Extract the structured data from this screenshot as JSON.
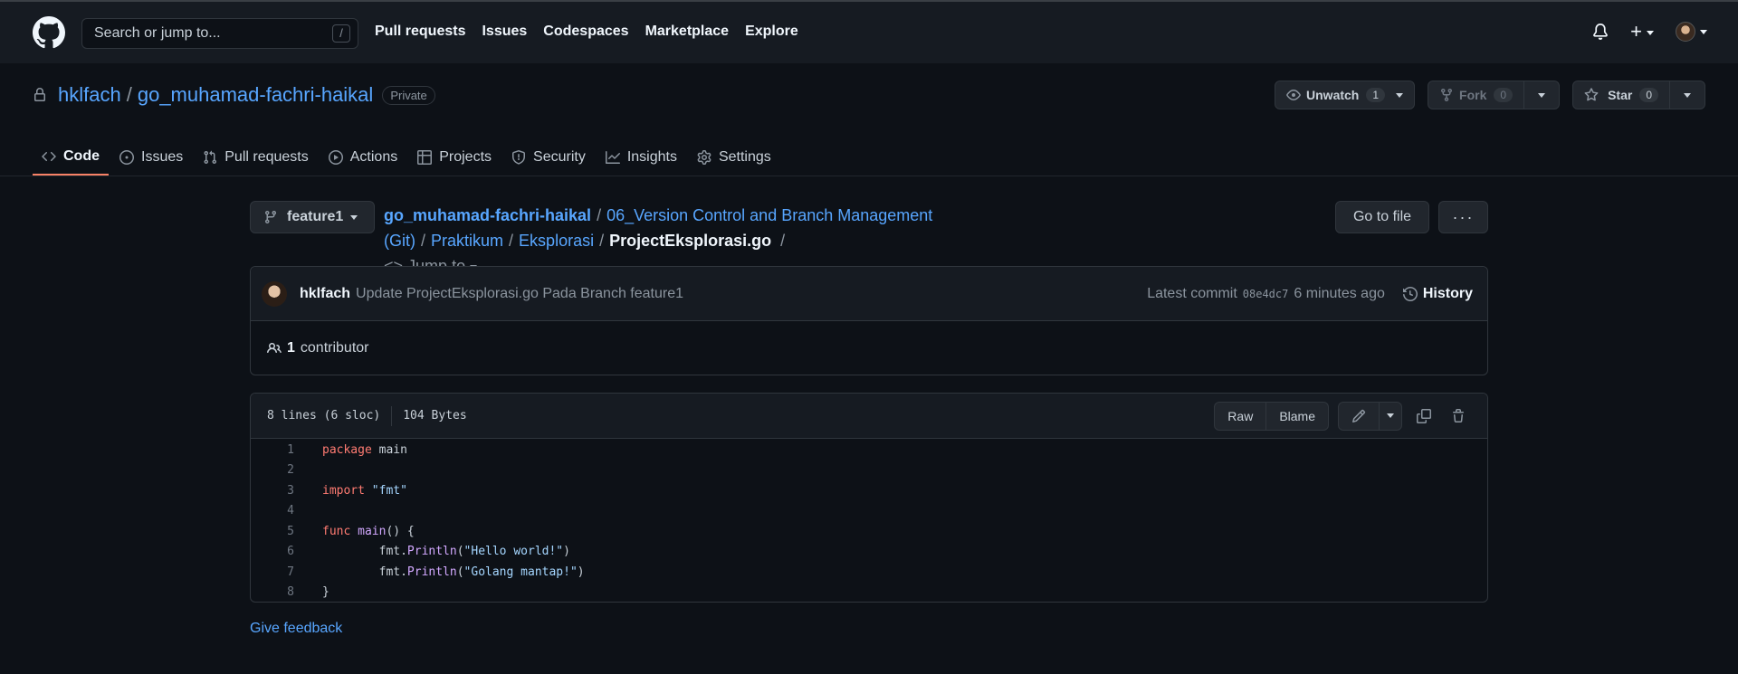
{
  "topbar": {
    "search_placeholder": "Search or jump to...",
    "search_shortcut": "/",
    "nav": [
      "Pull requests",
      "Issues",
      "Codespaces",
      "Marketplace",
      "Explore"
    ],
    "icons": [
      "bell-icon",
      "plus-icon",
      "avatar"
    ]
  },
  "repo": {
    "owner": "hklfach",
    "name": "go_muhamad-fachri-haikal",
    "visibility": "Private",
    "unwatch_label": "Unwatch",
    "watch_count": "1",
    "fork_label": "Fork",
    "fork_count": "0",
    "star_label": "Star",
    "star_count": "0"
  },
  "tabs": [
    {
      "label": "Code",
      "icon": "code-icon",
      "active": true
    },
    {
      "label": "Issues",
      "icon": "issue-icon"
    },
    {
      "label": "Pull requests",
      "icon": "pull-request-icon"
    },
    {
      "label": "Actions",
      "icon": "play-icon"
    },
    {
      "label": "Projects",
      "icon": "table-icon"
    },
    {
      "label": "Security",
      "icon": "shield-icon"
    },
    {
      "label": "Insights",
      "icon": "graph-icon"
    },
    {
      "label": "Settings",
      "icon": "gear-icon"
    }
  ],
  "file": {
    "branch": "feature1",
    "path": [
      "go_muhamad-fachri-haikal",
      "06_Version Control and Branch Management (Git)",
      "Praktikum",
      "Eksplorasi"
    ],
    "filename": "ProjectEksplorasi.go",
    "jump_to": "Jump to",
    "goto_label": "Go to file",
    "more_label": "···"
  },
  "commit": {
    "author": "hklfach",
    "message": "Update ProjectEksplorasi.go Pada Branch feature1",
    "latest_label": "Latest commit",
    "sha": "08e4dc7",
    "time": "6 minutes ago",
    "history_label": "History",
    "contributor_count": "1",
    "contributor_label": "contributor"
  },
  "code": {
    "lines_info": "8 lines (6 sloc)",
    "size": "104 Bytes",
    "raw_label": "Raw",
    "blame_label": "Blame",
    "lines": [
      {
        "n": "1",
        "parts": [
          [
            "kw",
            "package"
          ],
          [
            "",
            " main"
          ]
        ]
      },
      {
        "n": "2",
        "parts": []
      },
      {
        "n": "3",
        "parts": [
          [
            "kw",
            "import"
          ],
          [
            "",
            " "
          ],
          [
            "str",
            "\"fmt\""
          ]
        ]
      },
      {
        "n": "4",
        "parts": []
      },
      {
        "n": "5",
        "parts": [
          [
            "kw",
            "func"
          ],
          [
            "",
            " "
          ],
          [
            "fn",
            "main"
          ],
          [
            "",
            "() {"
          ]
        ]
      },
      {
        "n": "6",
        "parts": [
          [
            "",
            "        fmt."
          ],
          [
            "fn",
            "Println"
          ],
          [
            "",
            "("
          ],
          [
            "str",
            "\"Hello world!\""
          ],
          [
            "",
            ")"
          ]
        ]
      },
      {
        "n": "7",
        "parts": [
          [
            "",
            "        fmt."
          ],
          [
            "fn",
            "Println"
          ],
          [
            "",
            "("
          ],
          [
            "str",
            "\"Golang mantap!\""
          ],
          [
            "",
            ")"
          ]
        ]
      },
      {
        "n": "8",
        "parts": [
          [
            "",
            "}"
          ]
        ]
      }
    ]
  },
  "footer": {
    "feedback": "Give feedback"
  },
  "colors": {
    "accent": "#58a6ff",
    "active_tab": "#f78166",
    "bg": "#0d1117",
    "header": "#161b22"
  }
}
